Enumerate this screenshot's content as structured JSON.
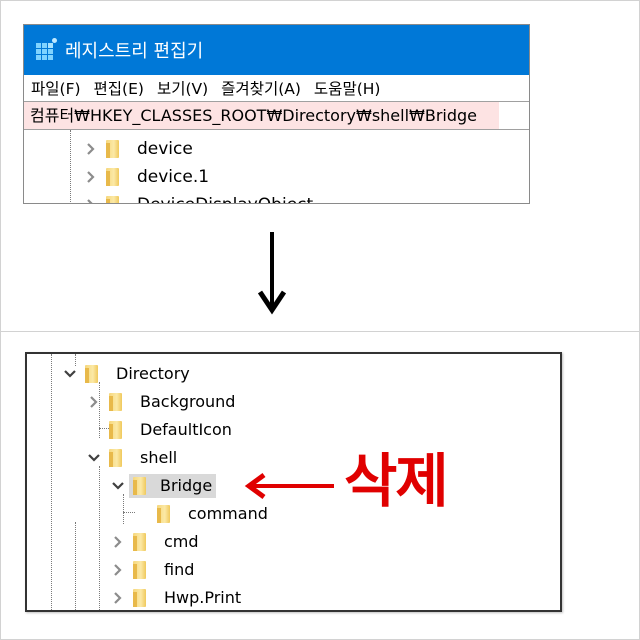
{
  "window": {
    "title": "레지스트리 편집기",
    "icon": "regedit-icon"
  },
  "menu": [
    {
      "label": "파일(F)"
    },
    {
      "label": "편집(E)"
    },
    {
      "label": "보기(V)"
    },
    {
      "label": "즐겨찾기(A)"
    },
    {
      "label": "도움말(H)"
    }
  ],
  "address": {
    "path": "컴퓨터₩HKEY_CLASSES_ROOT₩Directory₩shell₩Bridge",
    "highlight_color": "#fde3e3"
  },
  "top_tree": {
    "items": [
      {
        "label": "device",
        "expander": "collapsed"
      },
      {
        "label": "device.1",
        "expander": "collapsed"
      },
      {
        "label": "DeviceDisplayObject",
        "expander": "collapsed"
      }
    ]
  },
  "transition_arrow": {
    "icon": "down-arrow-icon"
  },
  "bottom_tree": {
    "items": [
      {
        "label": "Directory",
        "expander": "expanded",
        "level": 0
      },
      {
        "label": "Background",
        "expander": "collapsed",
        "level": 1
      },
      {
        "label": "DefaultIcon",
        "expander": "none",
        "level": 1
      },
      {
        "label": "shell",
        "expander": "expanded",
        "level": 1
      },
      {
        "label": "Bridge",
        "expander": "expanded",
        "level": 2,
        "selected": true
      },
      {
        "label": "command",
        "expander": "none",
        "level": 3
      },
      {
        "label": "cmd",
        "expander": "collapsed",
        "level": 2
      },
      {
        "label": "find",
        "expander": "collapsed",
        "level": 2
      },
      {
        "label": "Hwp.Print",
        "expander": "collapsed",
        "level": 2
      }
    ]
  },
  "annotation": {
    "text": "삭제",
    "color": "#e00000",
    "points_to": "Bridge"
  },
  "colors": {
    "titlebar": "#0078d7",
    "selection": "#d9d9d9"
  }
}
